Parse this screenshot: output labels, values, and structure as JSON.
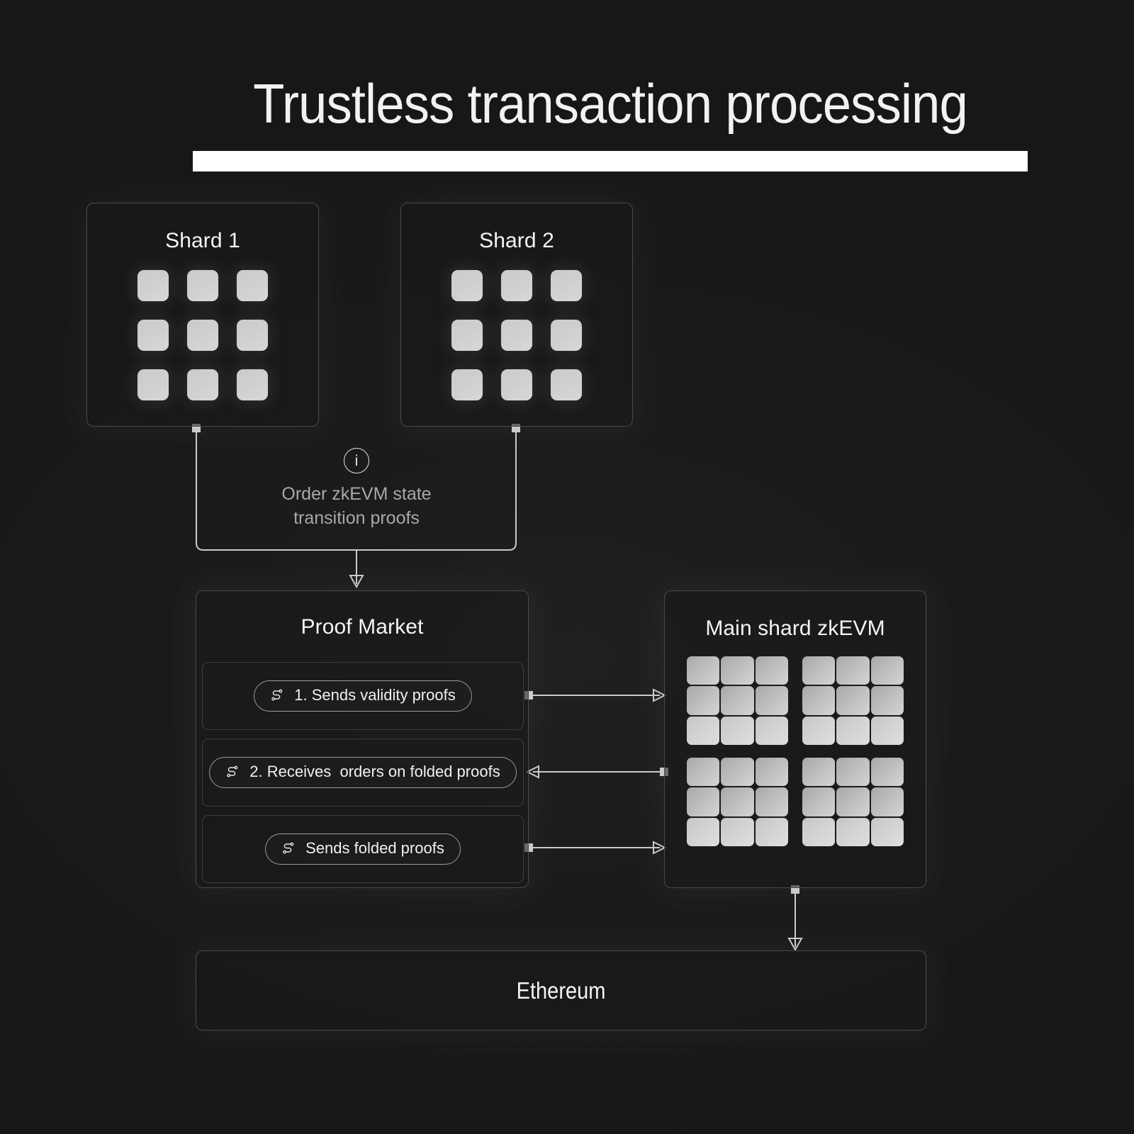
{
  "page": {
    "title": "Trustless transaction processing",
    "background_color": "#1a1a1a",
    "accent_color": "#ffffff",
    "text_color": "#f2f2f2",
    "muted_text_color": "#a8a8a8",
    "border_color": "#4a4a4a"
  },
  "shards": [
    {
      "label": "Shard 1",
      "tile_count": 9
    },
    {
      "label": "Shard 2",
      "tile_count": 9
    }
  ],
  "annotation": {
    "icon": "info-circle-icon",
    "icon_glyph": "i",
    "line1": "Order zkEVM state",
    "line2": "transition proofs"
  },
  "proof_market": {
    "title": "Proof Market",
    "steps": [
      {
        "icon": "route-path-icon",
        "label": "1. Sends validity proofs"
      },
      {
        "icon": "route-path-icon",
        "label": "2. Receives  orders on folded proofs"
      },
      {
        "icon": "route-path-icon",
        "label": "Sends folded proofs"
      }
    ]
  },
  "main_shard": {
    "title": "Main shard zkEVM",
    "block_count": 4,
    "tiles_per_block": 9
  },
  "ethereum": {
    "title": "Ethereum"
  },
  "connectors": [
    {
      "from": "shard-1",
      "to": "proof-market",
      "direction": "down"
    },
    {
      "from": "shard-2",
      "to": "proof-market",
      "direction": "down"
    },
    {
      "from": "proof-market-step-1",
      "to": "main-shard",
      "direction": "right"
    },
    {
      "from": "main-shard",
      "to": "proof-market-step-2",
      "direction": "left"
    },
    {
      "from": "proof-market-step-3",
      "to": "main-shard",
      "direction": "right"
    },
    {
      "from": "main-shard",
      "to": "ethereum",
      "direction": "down"
    }
  ]
}
